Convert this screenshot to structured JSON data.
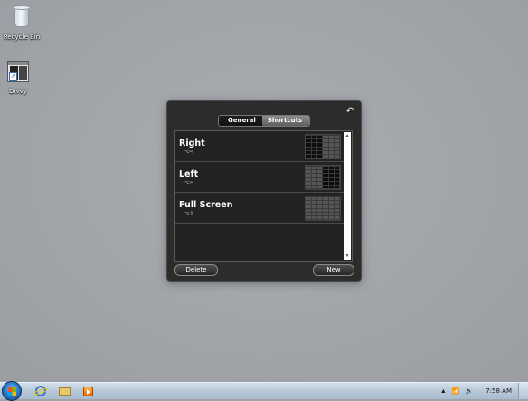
{
  "desktop": {
    "icons": [
      {
        "label": "Recycle Bin",
        "icon": "recycle-bin-icon"
      },
      {
        "label": "Divvy",
        "icon": "divvy-app-icon"
      }
    ]
  },
  "dialog": {
    "tabs": [
      {
        "label": "General",
        "active": false
      },
      {
        "label": "Shortcuts",
        "active": true
      }
    ],
    "shortcuts": [
      {
        "name": "Right",
        "key": "⌥⇨",
        "grid_rows": 6,
        "grid_cols": 6,
        "selected_cols": [
          0,
          1,
          2
        ]
      },
      {
        "name": "Left",
        "key": "⌥⇦",
        "grid_rows": 6,
        "grid_cols": 6,
        "selected_cols": [
          3,
          4,
          5
        ]
      },
      {
        "name": "Full Screen",
        "key": "⌥⇧",
        "grid_rows": 6,
        "grid_cols": 6,
        "selected_cols": []
      }
    ],
    "buttons": {
      "delete": "Delete",
      "new": "New"
    }
  },
  "taskbar": {
    "pinned": [
      "internet-explorer-icon",
      "windows-explorer-icon",
      "media-player-icon"
    ],
    "tray": {
      "expand": "▲",
      "network": "📶",
      "volume": "🔊",
      "clock": "7:58 AM"
    }
  }
}
